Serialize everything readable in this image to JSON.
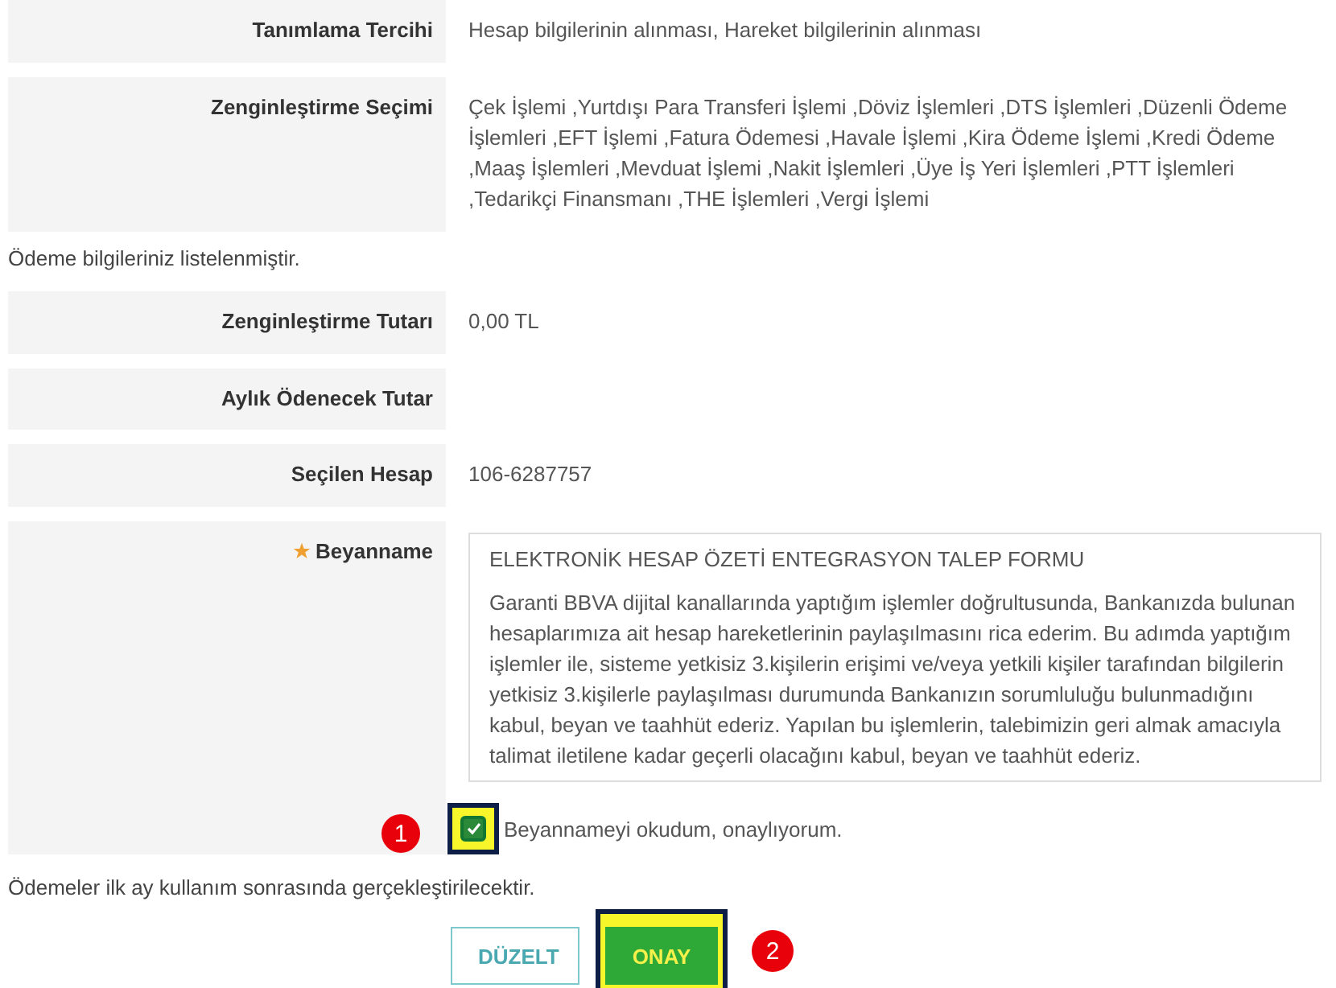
{
  "rows_top": [
    {
      "label": "Tanımlama Tercihi",
      "value": "Hesap bilgilerinin alınması, Hareket bilgilerinin alınması"
    },
    {
      "label": "Zenginleştirme Seçimi",
      "value": "Çek İşlemi ,Yurtdışı Para Transferi İşlemi ,Döviz İşlemleri ,DTS İşlemleri ,Düzenli Ödeme İşlemleri ,EFT İşlemi ,Fatura Ödemesi ,Havale İşlemi ,Kira Ödeme İşlemi ,Kredi Ödeme ,Maaş İşlemleri ,Mevduat İşlemi ,Nakit İşlemleri ,Üye İş Yeri İşlemleri ,PTT İşlemleri ,Tedarikçi Finansmanı ,THE İşlemleri ,Vergi İşlemi"
    }
  ],
  "notice": "Ödeme bilgileriniz listelenmiştir.",
  "rows_payment": [
    {
      "label": "Zenginleştirme Tutarı",
      "value": "0,00 TL"
    },
    {
      "label": "Aylık Ödenecek Tutar"
    },
    {
      "label": "Seçilen Hesap",
      "value": "106-6287757"
    }
  ],
  "declaration": {
    "label": "Beyanname",
    "required": true,
    "title": "ELEKTRONİK HESAP ÖZETİ ENTEGRASYON TALEP FORMU",
    "body": "Garanti BBVA dijital kanallarında yaptığım işlemler doğrultusunda, Bankanızda bulunan hesaplarımıza ait hesap hareketlerinin paylaşılmasını rica ederim. Bu adımda yaptığım işlemler ile, sisteme yetkisiz 3.kişilerin erişimi ve/veya yetkili kişiler tarafından bilgilerin yetkisiz 3.kişilerle paylaşılması durumunda Bankanızın sorumluluğu bulunmadığını kabul, beyan ve taahhüt ederiz. Yapılan bu işlemlerin, talebimizin geri almak amacıyla talimat iletilene kadar geçerli olacağını kabul, beyan ve taahhüt ederiz.",
    "consent": {
      "label": "Beyannameyi okudum, onaylıyorum.",
      "checked": true,
      "marker": "1"
    }
  },
  "footer_note": "Ödemeler ilk ay kullanım sonrasında gerçekleştirilecektir.",
  "buttons": [
    {
      "label": "DÜZELT",
      "kind": "secondary"
    },
    {
      "label": "ONAY",
      "kind": "primary",
      "marker": "2"
    }
  ]
}
